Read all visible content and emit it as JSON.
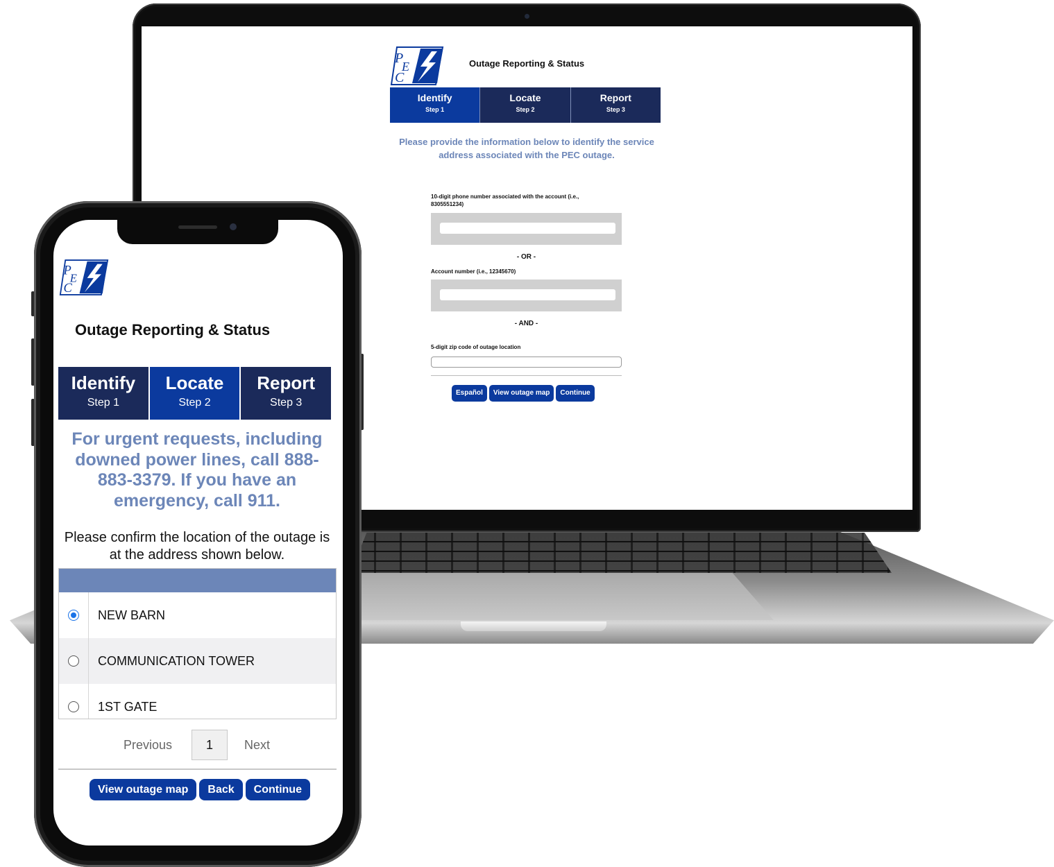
{
  "desktop": {
    "header": {
      "title": "Outage Reporting & Status"
    },
    "steps": [
      {
        "name": "Identify",
        "sub": "Step 1",
        "active": true
      },
      {
        "name": "Locate",
        "sub": "Step 2",
        "active": false
      },
      {
        "name": "Report",
        "sub": "Step 3",
        "active": false
      }
    ],
    "intro": "Please provide the information below to identify the service address associated with the PEC outage.",
    "phone_label": "10-digit phone number associated with the account (i.e., 8305551234)",
    "phone_value": "",
    "or_label": "- OR -",
    "account_label": "Account number (i.e., 12345670)",
    "account_value": "",
    "and_label": "- AND -",
    "zip_label": "5-digit zip code of outage location",
    "zip_value": "",
    "buttons": {
      "espanol": "Español",
      "view_map": "View outage map",
      "continue": "Continue"
    }
  },
  "mobile": {
    "header": {
      "title": "Outage Reporting & Status"
    },
    "steps": [
      {
        "name": "Identify",
        "sub": "Step 1",
        "active": false
      },
      {
        "name": "Locate",
        "sub": "Step 2",
        "active": true
      },
      {
        "name": "Report",
        "sub": "Step 3",
        "active": false
      }
    ],
    "urgent": "For urgent requests, including downed power lines, call 888-883-3379. If you have an emergency, call 911.",
    "confirm": "Please confirm the location of the outage is at the address shown below.",
    "locations": [
      {
        "name": "NEW BARN",
        "selected": true
      },
      {
        "name": "COMMUNICATION TOWER",
        "selected": false
      },
      {
        "name": "1ST GATE",
        "selected": false
      }
    ],
    "pager": {
      "previous": "Previous",
      "page": "1",
      "next": "Next"
    },
    "buttons": {
      "view_map": "View outage map",
      "back": "Back",
      "continue": "Continue"
    }
  },
  "colors": {
    "brand_blue": "#0b3a9e",
    "navy": "#1b2a5a",
    "muted_blue": "#6c86b8"
  },
  "icons": [
    "pec-logo-icon",
    "radio-checked-icon",
    "radio-unchecked-icon"
  ]
}
